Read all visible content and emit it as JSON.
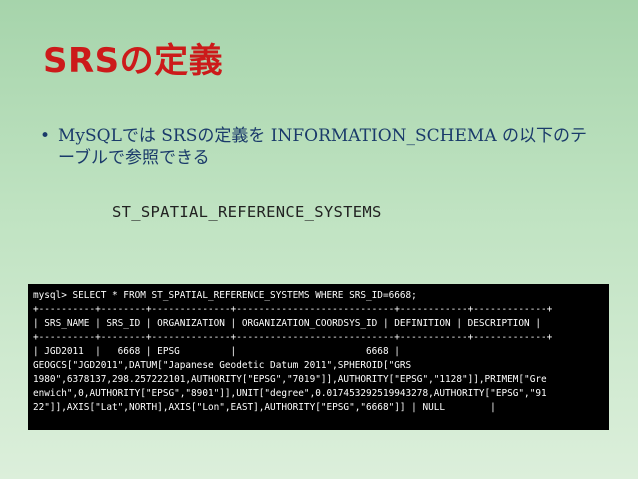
{
  "slide": {
    "title": "SRSの定義",
    "bullet": {
      "marker": "•",
      "text": "MySQLでは SRSの定義を INFORMATION_SCHEMA の以下のテーブルで参照できる"
    },
    "table_name": "ST_SPATIAL_REFERENCE_SYSTEMS",
    "console": {
      "lines": [
        "mysql> SELECT * FROM ST_SPATIAL_REFERENCE_SYSTEMS WHERE SRS_ID=6668;",
        "+----------+--------+--------------+----------------------------+------------+-------------+",
        "| SRS_NAME | SRS_ID | ORGANIZATION | ORGANIZATION_COORDSYS_ID | DEFINITION | DESCRIPTION |",
        "+----------+--------+--------------+----------------------------+------------+-------------+",
        "| JGD2011  |   6668 | EPSG         |                       6668 |",
        "GEOGCS[\"JGD2011\",DATUM[\"Japanese Geodetic Datum 2011\",SPHEROID[\"GRS",
        "1980\",6378137,298.257222101,AUTHORITY[\"EPSG\",\"7019\"]],AUTHORITY[\"EPSG\",\"1128\"]],PRIMEM[\"Gre",
        "enwich\",0,AUTHORITY[\"EPSG\",\"8901\"]],UNIT[\"degree\",0.017453292519943278,AUTHORITY[\"EPSG\",\"91",
        "22\"]],AXIS[\"Lat\",NORTH],AXIS[\"Lon\",EAST],AUTHORITY[\"EPSG\",\"6668\"]] | NULL        |"
      ]
    }
  }
}
